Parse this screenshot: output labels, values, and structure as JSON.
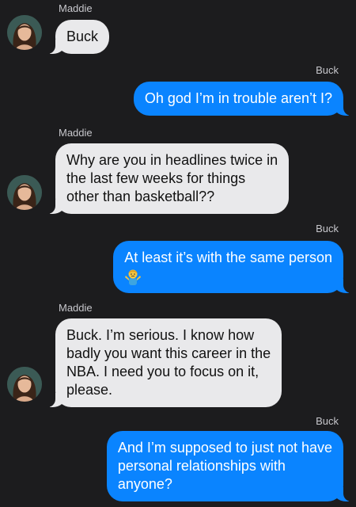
{
  "conversation": {
    "messages": [
      {
        "sender": "Maddie",
        "direction": "incoming",
        "lines": [
          "Buck"
        ]
      },
      {
        "sender": "Buck",
        "direction": "outgoing",
        "lines": [
          "Oh god I’m in trouble aren’t I?"
        ]
      },
      {
        "sender": "Maddie",
        "direction": "incoming",
        "lines": [
          "Why are you in headlines twice in",
          "the last few weeks for things",
          "other than basketball??"
        ]
      },
      {
        "sender": "Buck",
        "direction": "outgoing",
        "lines": [
          "At least it’s with the same person"
        ],
        "emoji": "person-shrugging-emoji"
      },
      {
        "sender": "Maddie",
        "direction": "incoming",
        "lines": [
          "Buck. I’m serious. I know how",
          "badly you want this career in the",
          "NBA. I need you to focus on it,",
          "please."
        ]
      },
      {
        "sender": "Buck",
        "direction": "outgoing",
        "lines": [
          "And I’m supposed to just not have",
          "personal relationships with",
          "anyone?"
        ]
      }
    ]
  },
  "colors": {
    "background": "#1c1c1e",
    "incoming_bubble": "#e9e9eb",
    "outgoing_bubble": "#0a84ff",
    "sender_name": "#c7c7cc"
  }
}
